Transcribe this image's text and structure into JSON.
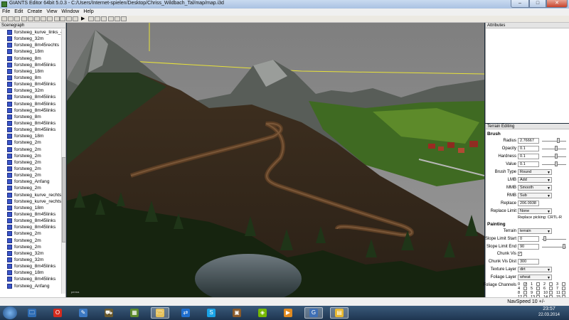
{
  "window": {
    "title": "GIANTS Editor 64bit 5.0.3 - C:/Users/Internet-spielen/Desktop/Chriss_Wildbach_Tal/map/map.i3d",
    "min": "–",
    "max": "□",
    "close": "✕"
  },
  "menu": [
    "File",
    "Edit",
    "Create",
    "View",
    "Window",
    "Help"
  ],
  "toolbar_icons": [
    "new-icon",
    "open-icon",
    "save-icon",
    "undo-icon",
    "redo-icon",
    "copy-icon",
    "paste-icon",
    "delete-icon",
    "select-icon",
    "move-icon",
    "rotate-icon",
    "scale-icon",
    "play-icon",
    "terrain-sculpt-icon",
    "terrain-paint-icon",
    "foliage-icon",
    "camera-icon",
    "grid-icon",
    "light-icon"
  ],
  "scenegraph": {
    "header": "Scenegraph",
    "items": [
      "forstweg_kurve_links_45",
      "forstweg_32m",
      "forstweg_8m45rechts",
      "forstweg_18m",
      "forstweg_8m",
      "forstweg_8m45links",
      "forstweg_18m",
      "forstweg_8m",
      "forstweg_8m45links",
      "forstweg_32m",
      "forstweg_8m45links",
      "forstweg_8m45links",
      "forstweg_8m45links",
      "forstweg_8m",
      "forstweg_8m45links",
      "forstweg_8m45links",
      "forstweg_18m",
      "forstweg_2m",
      "forstweg_2m",
      "forstweg_2m",
      "forstweg_2m",
      "forstweg_2m",
      "forstweg_2m",
      "forstweg_Anfang",
      "forstweg_2m",
      "forstweg_kurve_rechts_",
      "forstweg_kurve_rechts_",
      "forstweg_18m",
      "forstweg_8m45links",
      "forstweg_8m45links",
      "forstweg_8m45links",
      "forstweg_2m",
      "forstweg_2m",
      "forstweg_2m",
      "forstweg_32m",
      "forstweg_32m",
      "forstweg_8m45links",
      "forstweg_18m",
      "forstweg_8m45links",
      "forstweg_Anfang"
    ]
  },
  "attributes": {
    "header": "Attributes"
  },
  "terrain_editing": {
    "header": "Terrain Editing",
    "brush_section": "Brush",
    "radius": {
      "label": "Radius",
      "value": "2.76667",
      "level": 0.7
    },
    "opacity": {
      "label": "Opacity",
      "value": "0.1",
      "level": 0.6
    },
    "hardness": {
      "label": "Hardness",
      "value": "0.1",
      "level": 0.6
    },
    "value": {
      "label": "Value",
      "value": "0.1",
      "level": 0.6
    },
    "brush_type": {
      "label": "Brush Type",
      "value": "Round"
    },
    "lmb": {
      "label": "LMB",
      "value": "Add"
    },
    "mmb": {
      "label": "MMB",
      "value": "Smooth"
    },
    "rmb": {
      "label": "RMB",
      "value": "Sub"
    },
    "replace": {
      "label": "Replace",
      "value": "206.0938"
    },
    "replace_limit": {
      "label": "Replace Limit",
      "value": "None"
    },
    "replace_picking": "Replace picking: CRTL-R",
    "painting_section": "Painting",
    "terrain": {
      "label": "Terrain",
      "value": "terrain"
    },
    "slope_start": {
      "label": "Slope Limit Start",
      "value": "0",
      "level": 0.05
    },
    "slope_end": {
      "label": "Slope Limit End",
      "value": "90",
      "level": 0.95
    },
    "chunk_vis": {
      "label": "Chunk Vis",
      "checked": true,
      "mark": "✓"
    },
    "chunk_vis_dist": {
      "label": "Chunk Vis Dist",
      "value": "300"
    },
    "texture_layer": {
      "label": "Texture Layer",
      "value": "dirt"
    },
    "foliage_layer": {
      "label": "Foliage Layer",
      "value": "wheat"
    },
    "foliage_channels": {
      "label": "Foliage Channels",
      "numbers": [
        "0",
        "1",
        "2",
        "3",
        "4",
        "5",
        "6",
        "7",
        "8",
        "9",
        "10",
        "11",
        "12",
        "13",
        "14",
        "15"
      ],
      "checked": [
        true,
        false,
        false,
        false,
        false,
        false,
        false,
        false,
        false,
        false,
        false,
        false,
        false,
        false,
        false,
        false
      ]
    }
  },
  "status": {
    "navspeed": "NavSpeed 10 +/-"
  },
  "viewport_label": "perma",
  "taskbar": {
    "apps": [
      "windows-explorer-icon",
      "opera-icon",
      "paint-icon",
      "tractor-game-icon",
      "minecraft-icon",
      "folder-icon",
      "teamviewer-icon",
      "skype-icon",
      "media-icon",
      "nvidia-icon",
      "video-player-icon",
      "giants-editor-icon",
      "file-manager-icon"
    ],
    "clock": "23:57",
    "date": "22.03.2014"
  }
}
